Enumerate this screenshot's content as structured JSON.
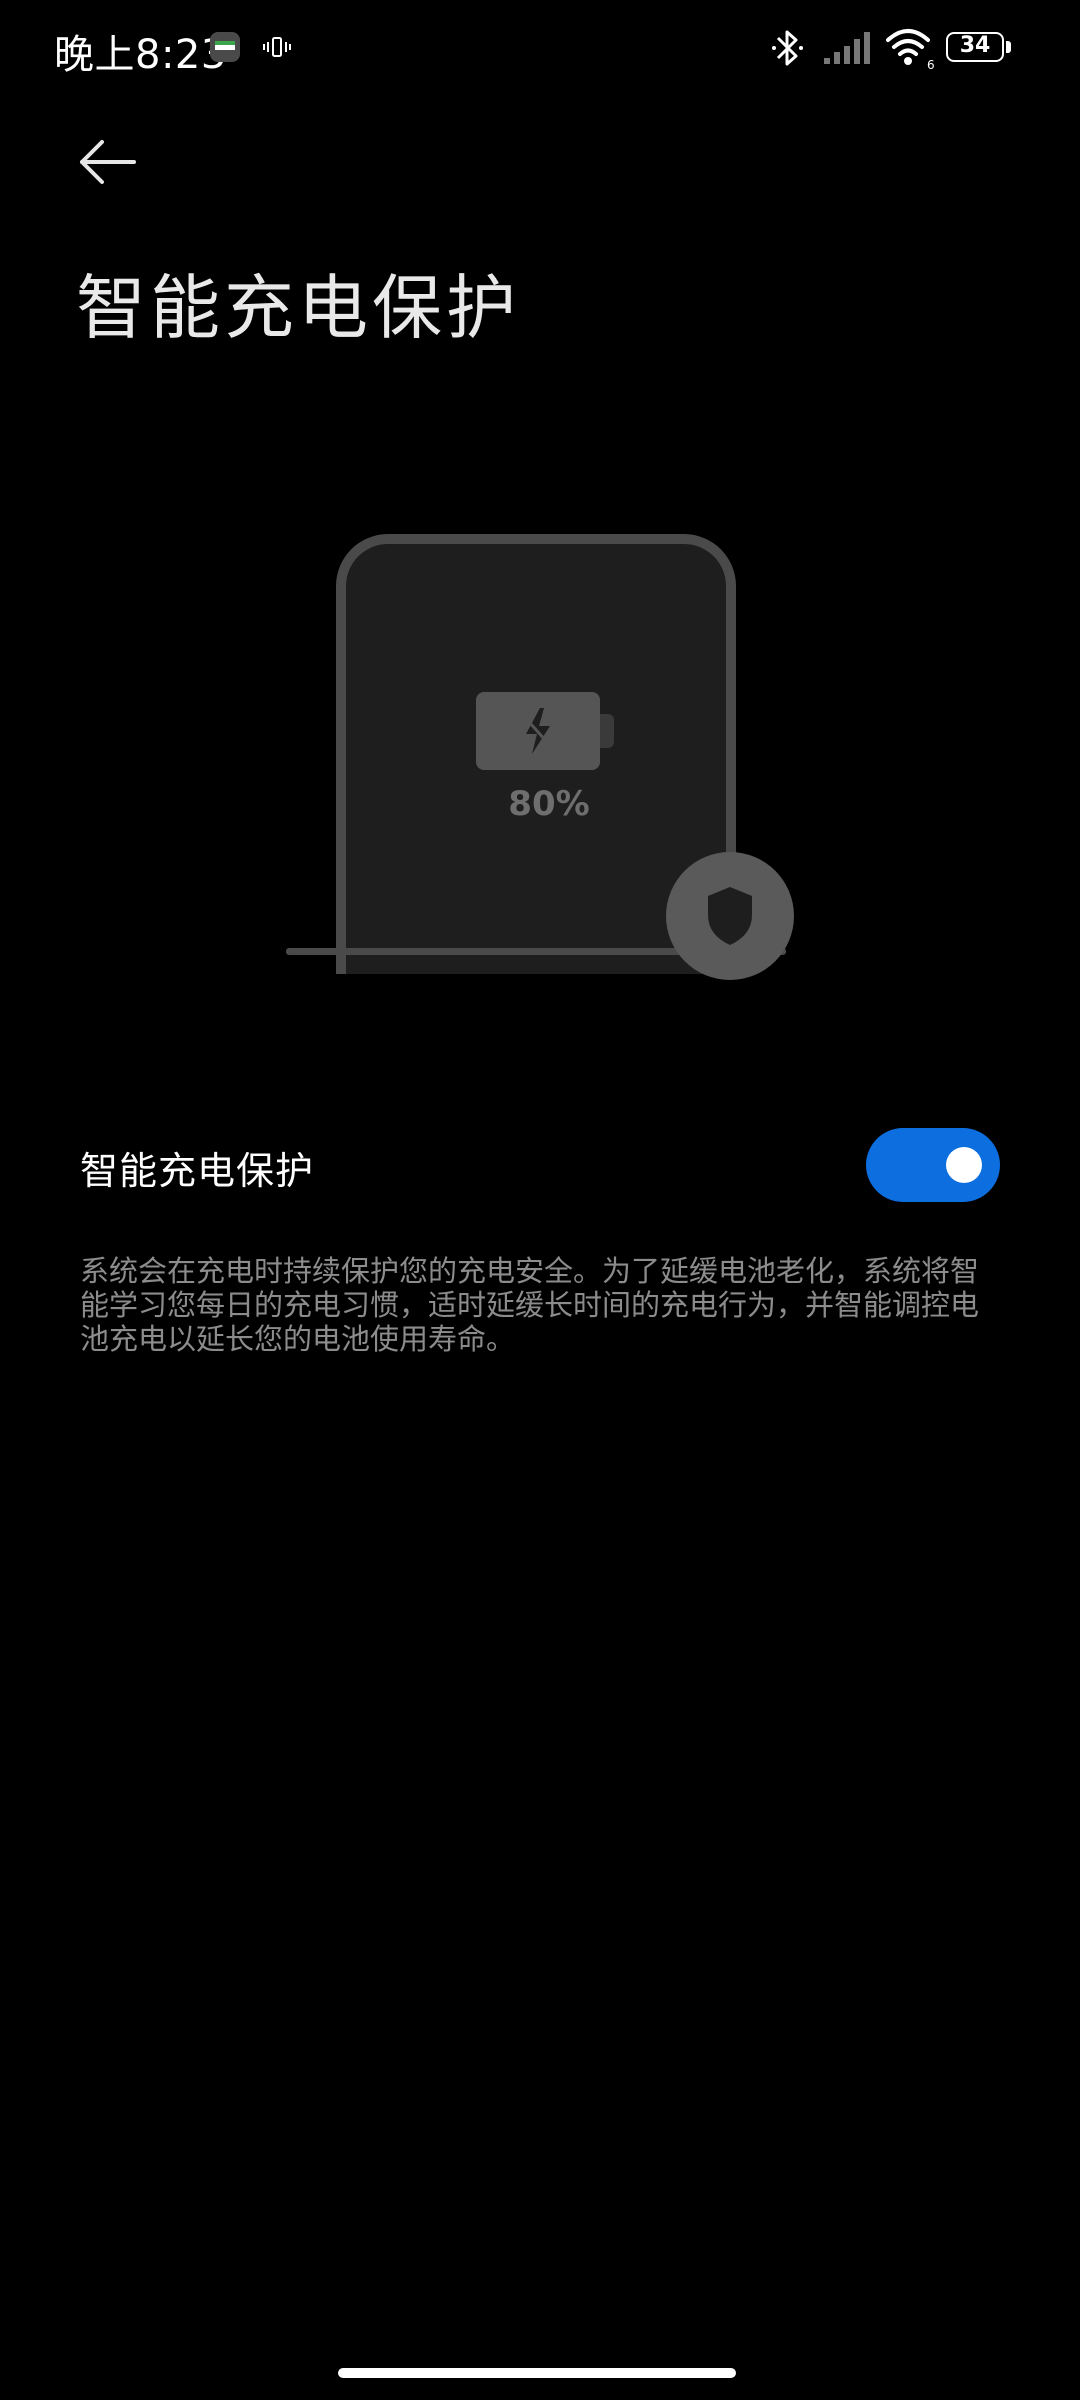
{
  "status_bar": {
    "time": "晚上8:23",
    "battery_level": "34",
    "wifi_label": "6"
  },
  "header": {
    "back_icon": "arrow-left-icon",
    "title": "智能充电保护"
  },
  "illustration": {
    "battery_percent": "80%",
    "icons": [
      "laptop-icon",
      "battery-charging-icon",
      "shield-icon"
    ]
  },
  "setting": {
    "label": "智能充电保护",
    "toggle_on": true,
    "toggle_color": "#0d6ee0"
  },
  "description": "系统会在充电时持续保护您的充电安全。为了延缓电池老化，系统将智能学习您每日的充电习惯，适时延缓长时间的充电行为，并智能调控电池充电以延长您的电池使用寿命。"
}
